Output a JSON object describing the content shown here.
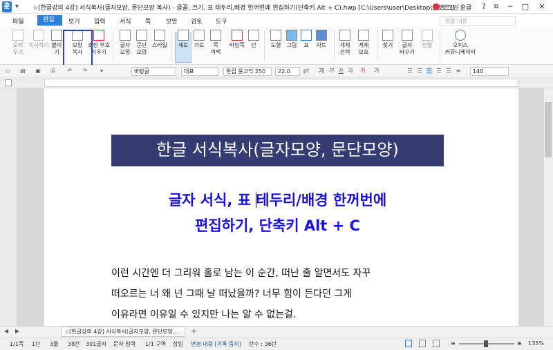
{
  "window": {
    "title": "☆[한글강의 4강] 서식복사(글자모양, 문단모양 복사) - 글꼴, 크기, 표 테두리,배경 한꺼번에 편집하기(단축키 Alt + C).hwp [C:\\Users\\user\\Desktop\\블로그\\] - 훈글",
    "login": "로그인",
    "buttons": {
      "help": "?",
      "restore": "⧉",
      "minimize": "─",
      "maximize": "□",
      "close": "✕"
    }
  },
  "menubar": {
    "items": [
      "파일",
      "편집",
      "보기",
      "입력",
      "서식",
      "쪽",
      "보안",
      "검토",
      "도구"
    ],
    "active": "편집",
    "search_placeholder": "찾을 내용"
  },
  "ribbon": {
    "tools": [
      {
        "label": "오려\n두기",
        "icon": "scissors-icon"
      },
      {
        "label": "복사하기",
        "icon": "copy-icon"
      },
      {
        "label": "붙이기",
        "icon": "paste-icon"
      },
      {
        "label": "모양\n복사",
        "icon": "format-painter-icon"
      },
      {
        "label": "조판 부호\n지우기",
        "icon": "clear-code-icon"
      },
      {
        "label": "글자\n모양",
        "icon": "char-shape-icon"
      },
      {
        "label": "문단\n모양",
        "icon": "para-shape-icon"
      },
      {
        "label": "스타일",
        "icon": "style-icon"
      },
      {
        "label": "세로",
        "icon": "portrait-icon"
      },
      {
        "label": "가로",
        "icon": "landscape-icon"
      },
      {
        "label": "쪽\n여백",
        "icon": "margin-icon"
      },
      {
        "label": "바탕쪽",
        "icon": "master-page-icon"
      },
      {
        "label": "단",
        "icon": "column-icon"
      },
      {
        "label": "도형",
        "icon": "shape-icon"
      },
      {
        "label": "그림",
        "icon": "picture-icon"
      },
      {
        "label": "표",
        "icon": "table-icon"
      },
      {
        "label": "차트",
        "icon": "chart-icon"
      },
      {
        "label": "개체\n선택",
        "icon": "select-object-icon"
      },
      {
        "label": "개체\n보호",
        "icon": "protect-object-icon"
      },
      {
        "label": "찾기",
        "icon": "find-icon"
      },
      {
        "label": "글자\n바꾸기",
        "icon": "replace-icon"
      },
      {
        "label": "정렬",
        "icon": "sort-icon"
      },
      {
        "label": "오피스\n커뮤니케이터",
        "icon": "communicator-icon"
      }
    ]
  },
  "formatbar": {
    "style": "바탕글",
    "lang": "대표",
    "font": "한컴 윤고딕 250",
    "size": "22.0",
    "unit": "pt",
    "zoom": "140"
  },
  "document": {
    "banner": "한글 서식복사(글자모양, 문단모양)",
    "heading1": "글자 서식, 표 테두리/배경 한꺼번에",
    "heading2": "편집하기, 단축키 Alt + C",
    "paragraph": [
      "이런 시간엔 더 그리워 홀로 남는 이 순간, 떠난 줄 알면서도 자꾸",
      "떠오르는 너 왜 넌 그때 날 떠났을까? 너무 힘이 든다던 그게",
      "이유라면 이유일 수 있지만 나는 알 수 없는걸."
    ]
  },
  "tabbar": {
    "tab_label": "☆[한글강의 4강] 서식복사(글자모양, 문단모양…",
    "add": "+"
  },
  "statusbar": {
    "page": "1/1쪽",
    "section": "1단",
    "line": "3줄",
    "column": "38칸",
    "chars": "391글자",
    "mode": "문자 입력",
    "area": "1/1 구역",
    "insert": "삽입",
    "track": "변경 내용 [기록 중지]",
    "pagetype": "탄수 : 36탄",
    "zoom": "135%"
  },
  "colors": {
    "accent": "#2f7fd6",
    "banner": "#343c73",
    "heading": "#1a10e6",
    "highlight": "#2b3fc9"
  }
}
